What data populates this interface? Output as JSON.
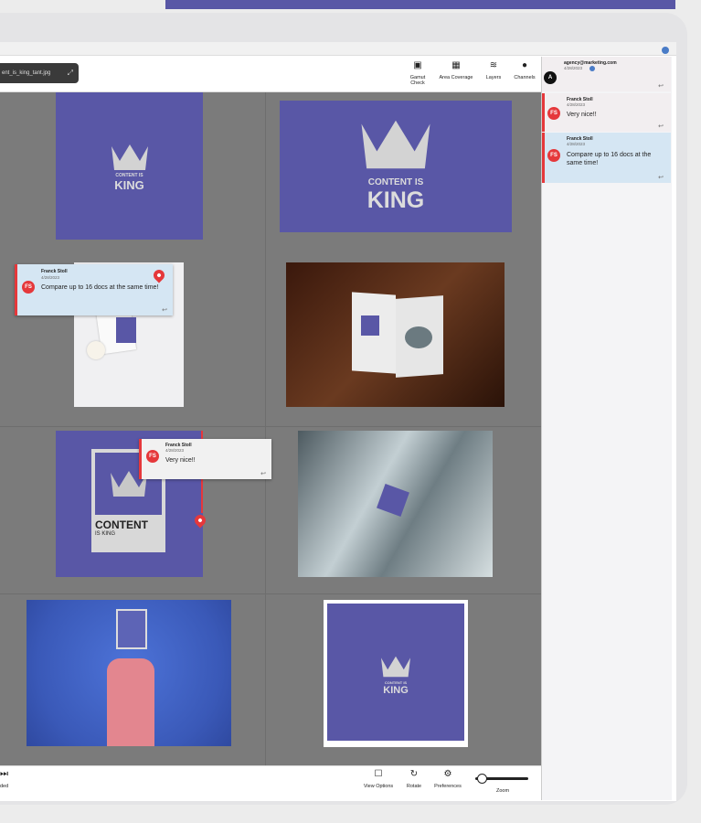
{
  "app": {
    "filename": "ent_is_king_tant.jpg",
    "expand_icon": "expand-icon"
  },
  "toolbar": {
    "items": [
      {
        "label": "Gamut Check",
        "icon": "gamut-icon"
      },
      {
        "label": "Area Coverage",
        "icon": "area-coverage-icon"
      },
      {
        "label": "Layers",
        "icon": "layers-icon"
      },
      {
        "label": "Channels",
        "icon": "channels-icon"
      }
    ]
  },
  "bottom_toolbar": {
    "left_label": "ded",
    "items": [
      {
        "label": "View Options",
        "icon": "view-options-icon"
      },
      {
        "label": "Rotate",
        "icon": "rotate-icon"
      },
      {
        "label": "Preferences",
        "icon": "preferences-icon"
      },
      {
        "label": "Zoom",
        "icon": "zoom-slider"
      }
    ]
  },
  "logo": {
    "line1": "CONTENT IS",
    "line2": "KING",
    "poster_line1": "CONTENT",
    "poster_line2": "IS KING"
  },
  "comments_panel": {
    "comments": [
      {
        "author": "agency@marketing.com",
        "date": "4/28/2023",
        "initials": "A",
        "text": ""
      },
      {
        "author": "Franck Stoll",
        "date": "4/28/2023",
        "initials": "FS",
        "text": "Very nice!!"
      },
      {
        "author": "Franck Stoll",
        "date": "4/28/2023",
        "initials": "FS",
        "text": "Compare up to 16 docs at the same time!"
      }
    ]
  },
  "canvas_popups": {
    "popup1": {
      "author": "Franck Stoll",
      "date": "4/28/2023",
      "initials": "FS",
      "text": "Compare up to 16 docs at the same time!"
    },
    "popup2": {
      "author": "Franck Stoll",
      "date": "4/28/2023",
      "initials": "FS",
      "text": "Very nice!!"
    }
  },
  "colors": {
    "brand_purple": "#5957a6",
    "pin_red": "#e5383b",
    "highlight_blue": "#d5e6f3"
  }
}
